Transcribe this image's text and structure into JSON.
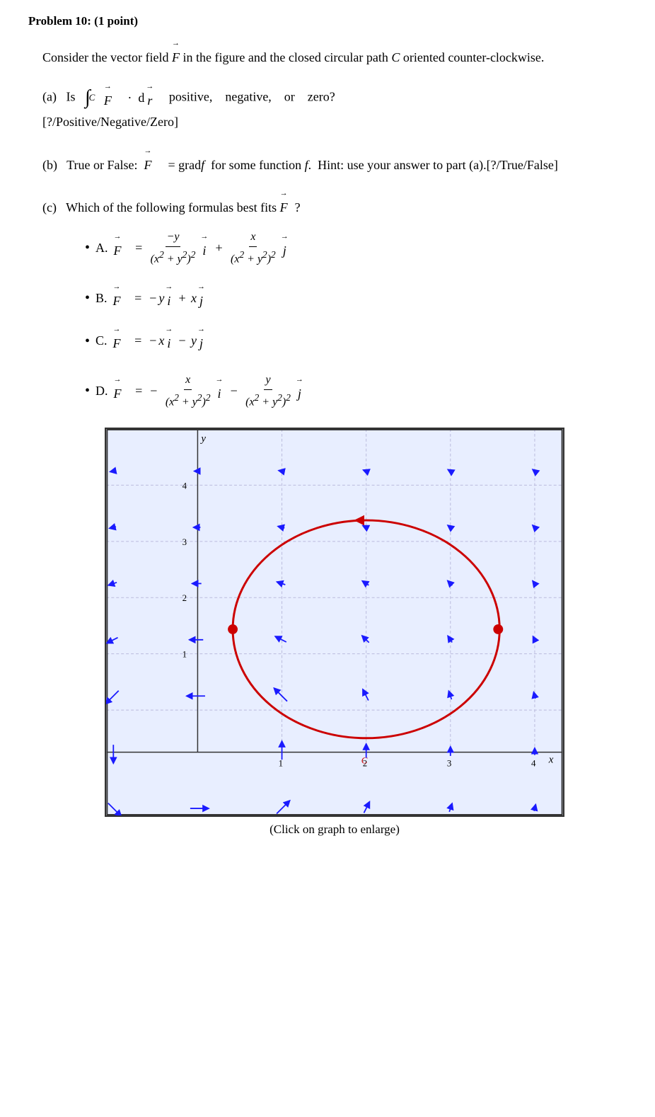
{
  "header": {
    "title": "Problem 10: (1 point)"
  },
  "intro": {
    "text": "Consider the vector field F⃗ in the figure and the closed circular path C oriented counter-clockwise."
  },
  "parts": {
    "a": {
      "label": "(a)",
      "question": "Is",
      "integral_text": "∫_C F⃗ · dr⃗",
      "options_text": "positive,   negative,   or   zero?",
      "answer_placeholder": "[?/Positive/Negative/Zero]"
    },
    "b": {
      "label": "(b)",
      "question": "True or False:  F⃗ = grad f  for some function f.  Hint: use your answer to part (a).",
      "answer_placeholder": "[?/True/False]"
    },
    "c": {
      "label": "(c)",
      "question": "Which of the following formulas best fits F⃗?"
    }
  },
  "options": [
    {
      "id": "A",
      "label": "A."
    },
    {
      "id": "B",
      "label": "B."
    },
    {
      "id": "C",
      "label": "C."
    },
    {
      "id": "D",
      "label": "D."
    }
  ],
  "graph": {
    "caption": "(Click on graph to enlarge)"
  },
  "colors": {
    "arrow_blue": "#1a1aff",
    "circle_red": "#cc0000",
    "dot_red": "#cc0000",
    "axis_black": "#000000",
    "grid_gray": "#bbbbdd"
  }
}
